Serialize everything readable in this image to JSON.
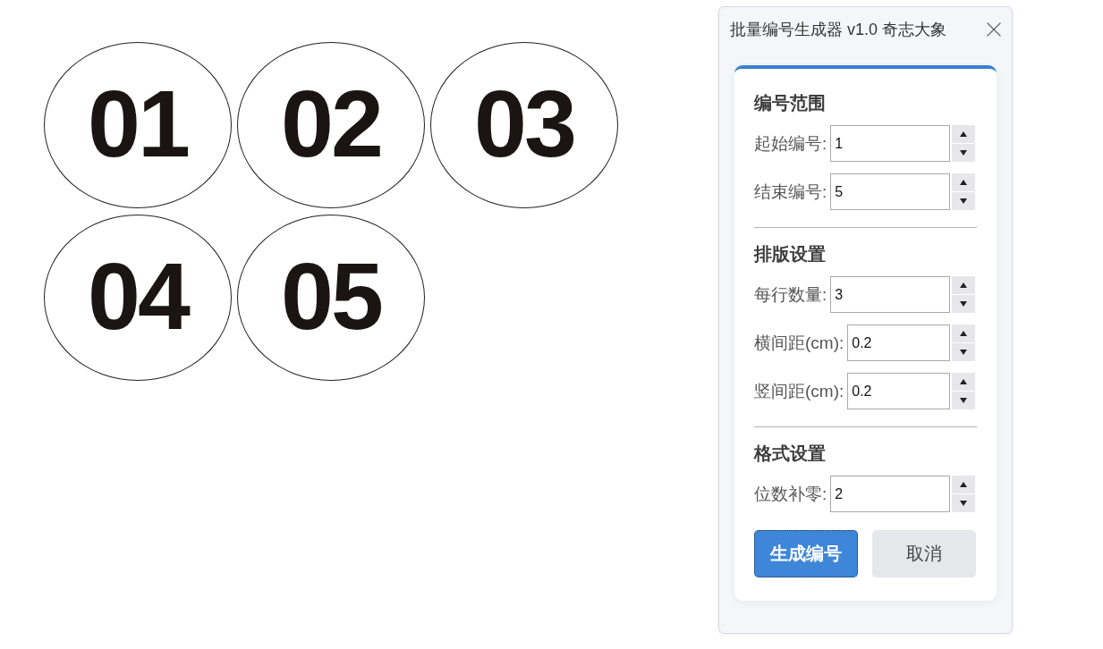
{
  "preview": {
    "labels": [
      "01",
      "02",
      "03",
      "04",
      "05"
    ]
  },
  "dialog": {
    "title": "批量编号生成器 v1.0 奇志大象",
    "sections": [
      {
        "heading": "编号范围",
        "fields": [
          {
            "label": "起始编号:",
            "value": "1"
          },
          {
            "label": "结束编号:",
            "value": "5"
          }
        ]
      },
      {
        "heading": "排版设置",
        "fields": [
          {
            "label": "每行数量:",
            "value": "3"
          },
          {
            "label": "横间距(cm):",
            "value": "0.2"
          },
          {
            "label": "竖间距(cm):",
            "value": "0.2"
          }
        ]
      },
      {
        "heading": "格式设置",
        "fields": [
          {
            "label": "位数补零:",
            "value": "2"
          }
        ]
      }
    ],
    "buttons": [
      {
        "label": "生成编号",
        "kind": "primary",
        "focused": true
      },
      {
        "label": "取消",
        "kind": "secondary",
        "focused": false
      }
    ]
  }
}
